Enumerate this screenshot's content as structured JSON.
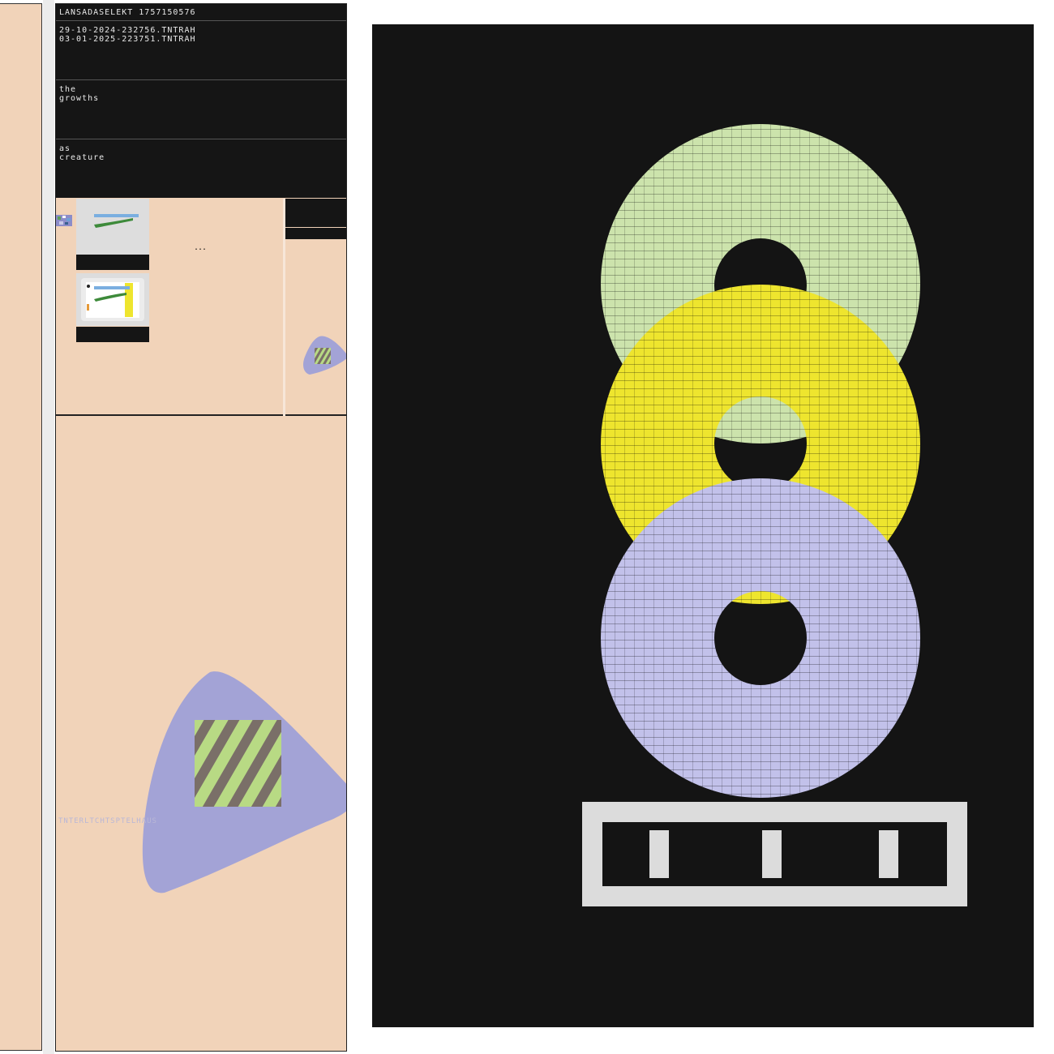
{
  "panel": {
    "title": "LANSADASELEKT 1757150576",
    "entries": [
      "29-10-2024-232756.TNTRAH",
      "03-01-2025-223751.TNTRAH"
    ],
    "note1": "the\ngrowths",
    "note2": "as\ncreature",
    "ellipsis": "...",
    "footer": "TNTERLTCHTSPTELHAUS"
  },
  "colors": {
    "background": "#f1d3b9",
    "dark": "#151515",
    "blob": "#a3a3d6",
    "ring_green": "#cce3ac",
    "ring_yellow": "#eee52e",
    "ring_lavender": "#c2c1ea",
    "frame": "#dcdcdc"
  },
  "icons": [
    "mosaic-icon",
    "ring-stack-artwork"
  ]
}
